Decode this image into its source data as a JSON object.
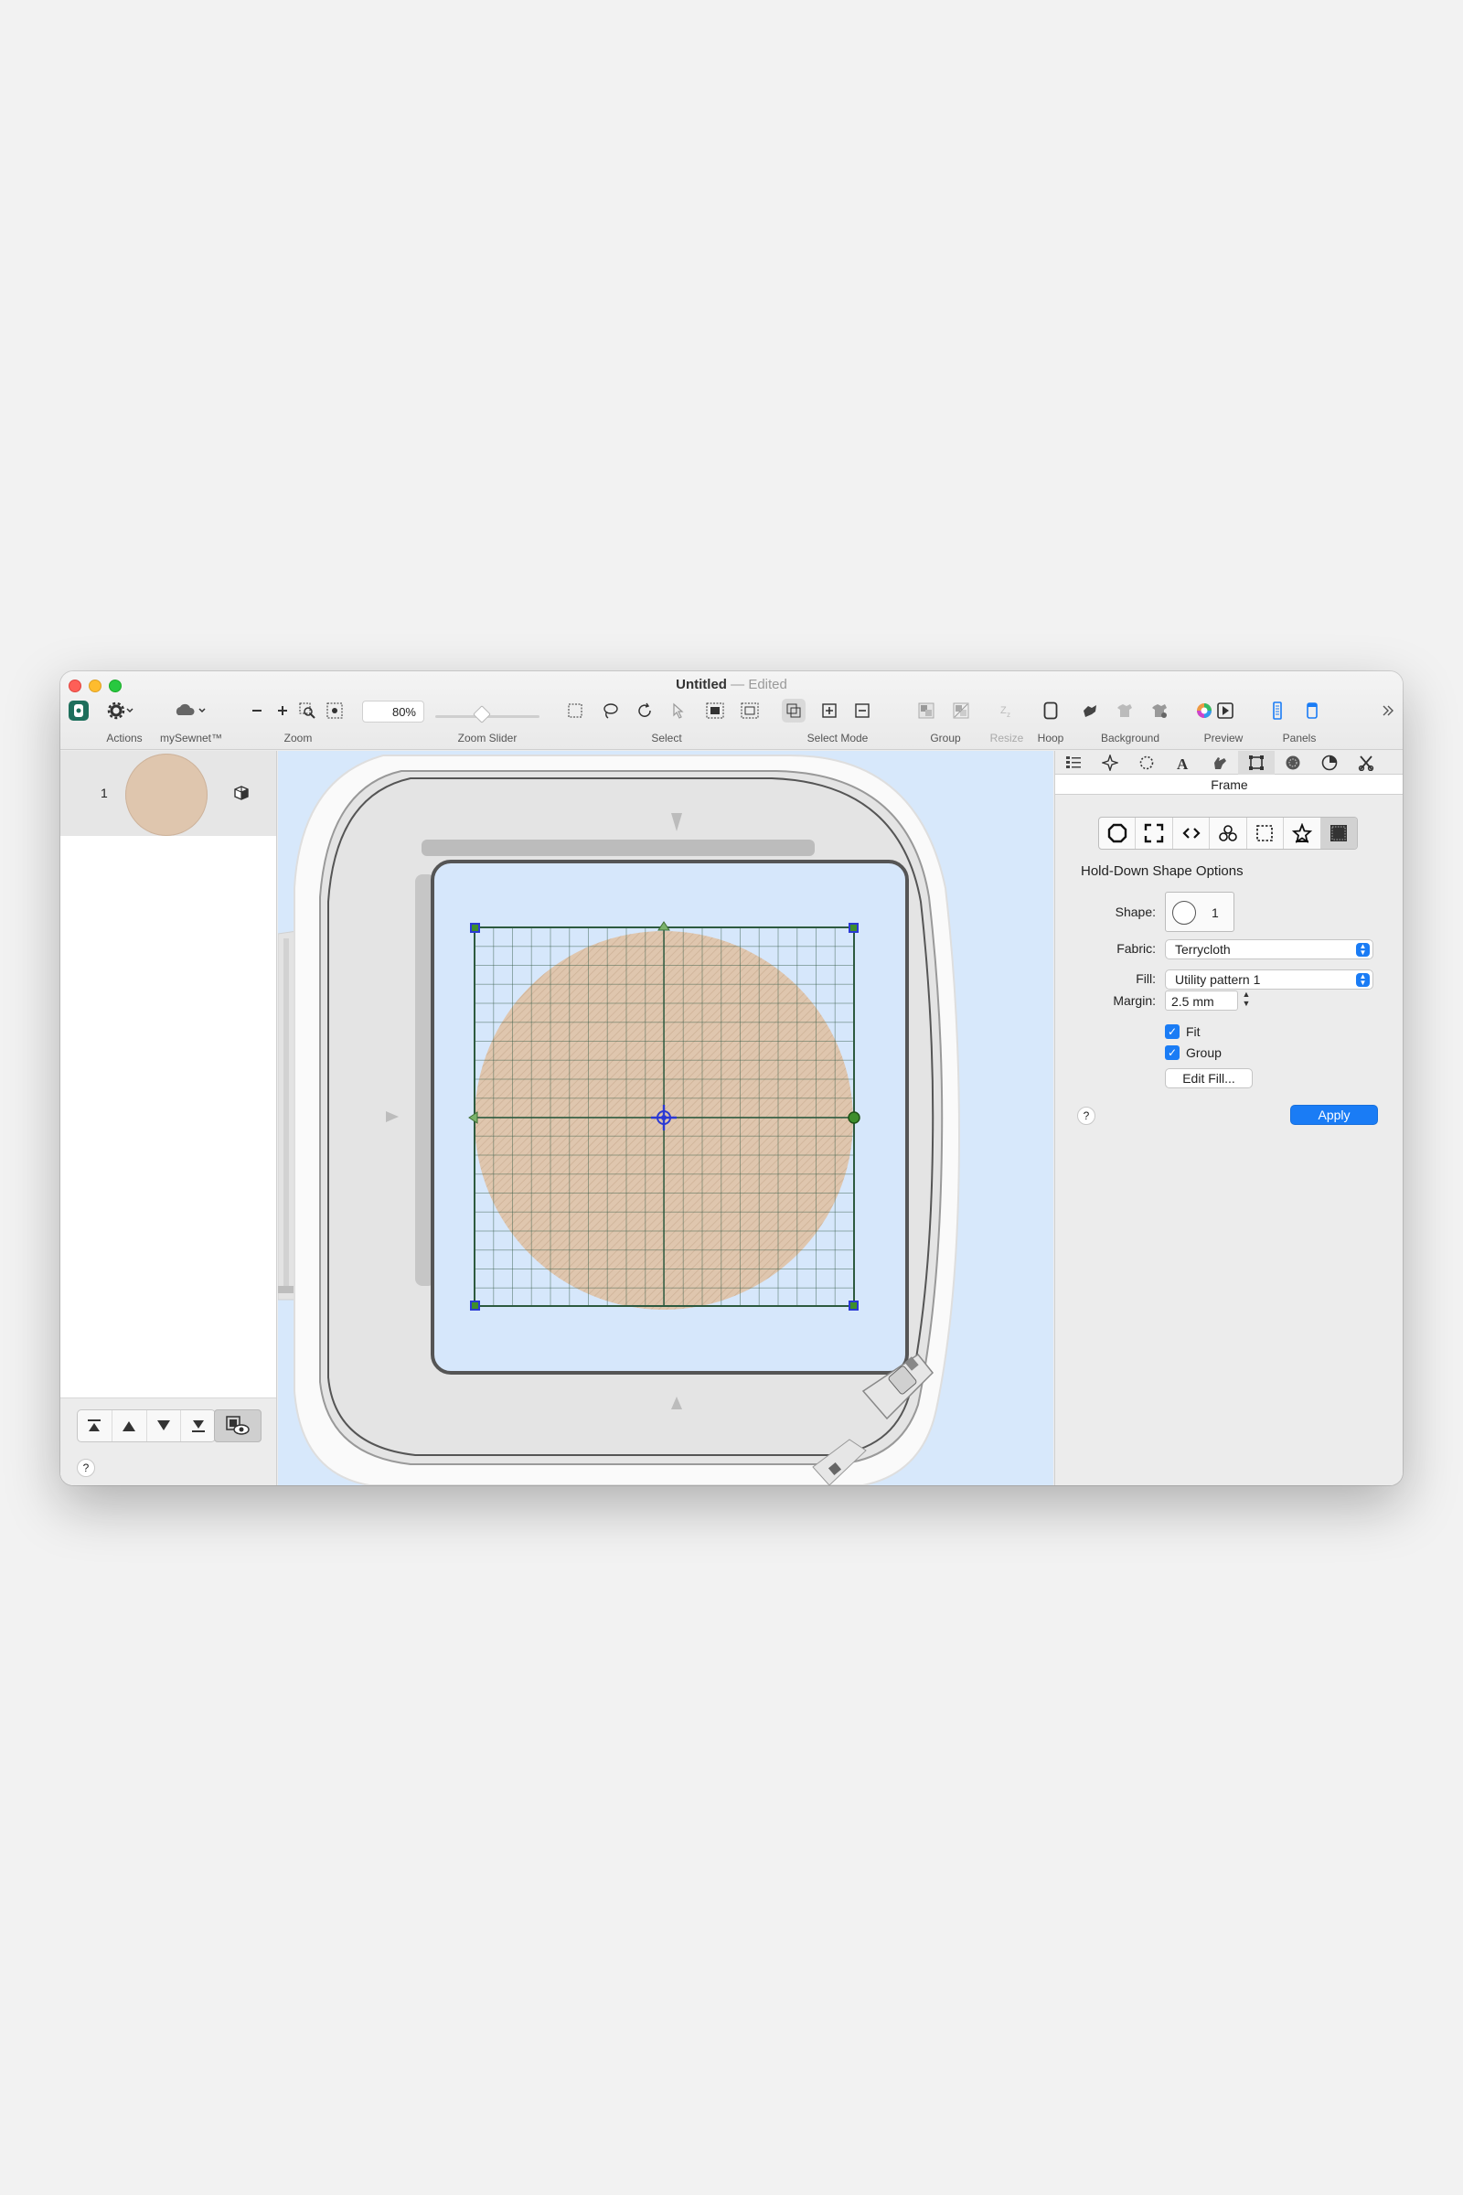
{
  "window": {
    "title": "Untitled",
    "separator": "—",
    "status": "Edited"
  },
  "toolbar": {
    "zoom_value": "80%",
    "zoom_level": 0.45,
    "labels": {
      "actions": "Actions",
      "mysewnet": "mySewnet™",
      "zoom": "Zoom",
      "zoom_slider": "Zoom Slider",
      "select": "Select",
      "select_mode": "Select Mode",
      "group": "Group",
      "resize": "Resize",
      "hoop": "Hoop",
      "background": "Background",
      "preview": "Preview",
      "panels": "Panels"
    },
    "icons": [
      "app-icon",
      "gear-icon",
      "cloud-icon",
      "zoom-out-icon",
      "zoom-in-icon",
      "zoom-to-rect-icon",
      "zoom-fit-icon",
      "marquee-select-icon",
      "lasso-icon",
      "rotate-select-icon",
      "select-arrow-icon",
      "select-all-icon",
      "deselect-icon",
      "select-mode-intersect-icon",
      "select-mode-add-icon",
      "select-mode-subtract-icon",
      "group-icon",
      "ungroup-icon",
      "resize-icon",
      "hoop-icon",
      "background-icon",
      "background-off-icon",
      "background-edit-icon",
      "color-wheel-icon",
      "play-icon",
      "panel-left-icon",
      "panel-right-icon",
      "more-icon"
    ]
  },
  "layers": {
    "items": [
      {
        "number": "1",
        "color": "#dfc6ae"
      }
    ]
  },
  "right_panel": {
    "tabs": [
      "list-tab",
      "star-tab",
      "dotted-circle-tab",
      "letter-a-tab",
      "hand-tab",
      "frame-tab",
      "pattern-tab",
      "pie-tab",
      "tools-tab"
    ],
    "active_tab": 5,
    "section_title": "Frame",
    "options_title": "Hold-Down Shape Options",
    "shape_label": "Shape:",
    "shape_number": "1",
    "fabric_label": "Fabric:",
    "fabric_value": "Terrycloth",
    "fill_label": "Fill:",
    "fill_value": "Utility pattern 1",
    "margin_label": "Margin:",
    "margin_value": "2.5 mm",
    "fit_label": "Fit",
    "group_label": "Group",
    "edit_fill_label": "Edit Fill...",
    "apply_label": "Apply",
    "help": "?"
  },
  "left_help": "?",
  "colors": {
    "accent": "#1a7cf5",
    "canvas_bg": "#d7e8fb",
    "fabric": "#dfc6ae",
    "handle_green": "#3e8e2c",
    "handle_blue": "#2a39d4"
  }
}
